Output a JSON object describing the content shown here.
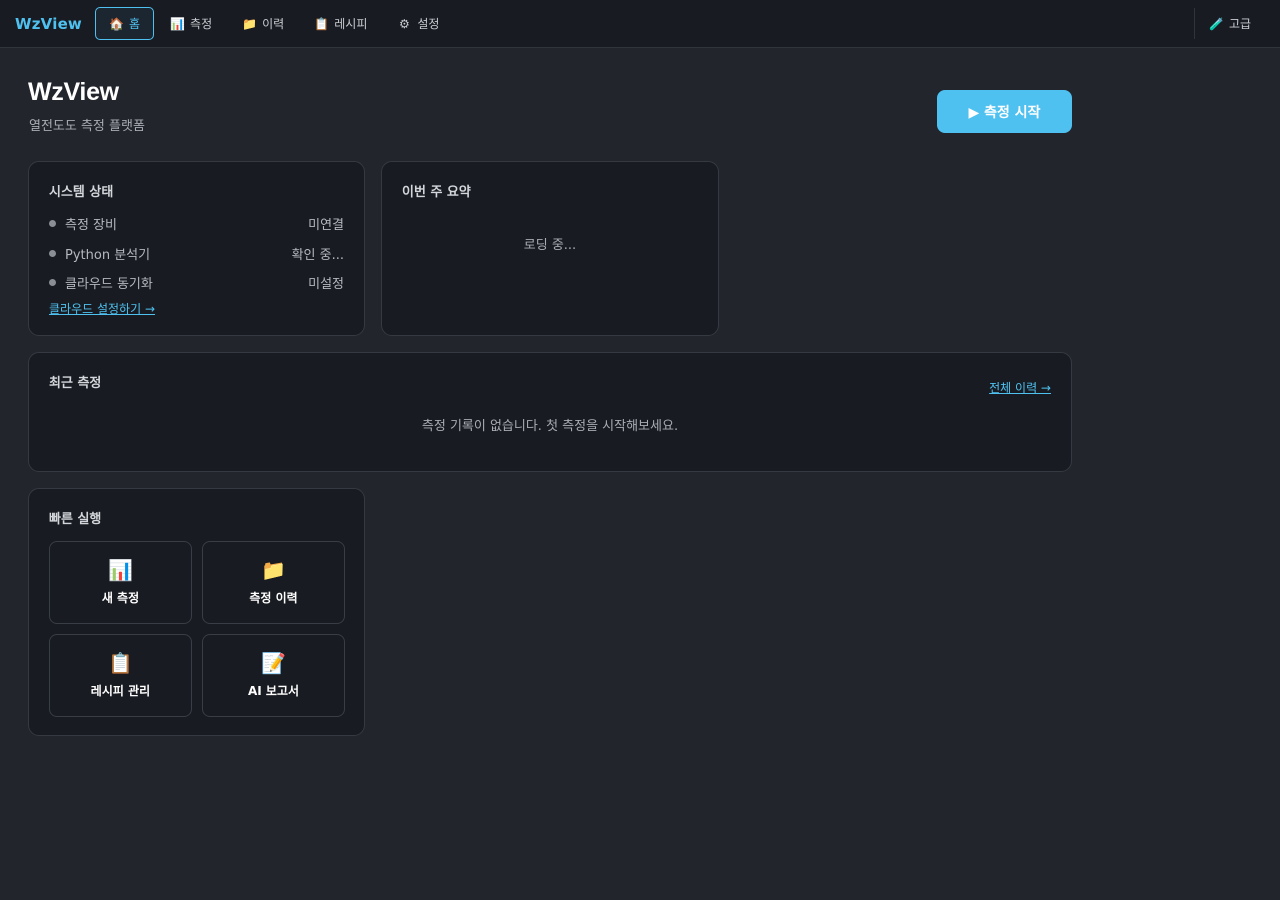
{
  "nav": {
    "brand": "WzView",
    "items": [
      {
        "icon": "🏠",
        "label": "홈",
        "active": true
      },
      {
        "icon": "📊",
        "label": "측정",
        "active": false
      },
      {
        "icon": "📁",
        "label": "이력",
        "active": false
      },
      {
        "icon": "📋",
        "label": "레시피",
        "active": false
      },
      {
        "icon": "⚙",
        "label": "설정",
        "active": false
      }
    ],
    "advanced": {
      "icon": "🧪",
      "label": "고급"
    }
  },
  "header": {
    "title": "WzView",
    "subtitle": "열전도도 측정 플랫폼",
    "start_button": "▶ 측정 시작"
  },
  "system_status": {
    "title": "시스템 상태",
    "rows": [
      {
        "label": "측정 장비",
        "value": "미연결"
      },
      {
        "label": "Python 분석기",
        "value": "확인 중..."
      },
      {
        "label": "클라우드 동기화",
        "value": "미설정"
      }
    ],
    "link": "클라우드 설정하기 →"
  },
  "weekly_summary": {
    "title": "이번 주 요약",
    "loading": "로딩 중..."
  },
  "recent": {
    "title": "최근 측정",
    "link": "전체 이력 →",
    "empty": "측정 기록이 없습니다. 첫 측정을 시작해보세요."
  },
  "quick": {
    "title": "빠른 실행",
    "tiles": [
      {
        "icon": "📊",
        "label": "새 측정"
      },
      {
        "icon": "📁",
        "label": "측정 이력"
      },
      {
        "icon": "📋",
        "label": "레시피 관리"
      },
      {
        "icon": "📝",
        "label": "AI 보고서"
      }
    ]
  },
  "colors": {
    "accent": "#4fc1f0",
    "background": "#22252b",
    "card": "#181b21"
  }
}
